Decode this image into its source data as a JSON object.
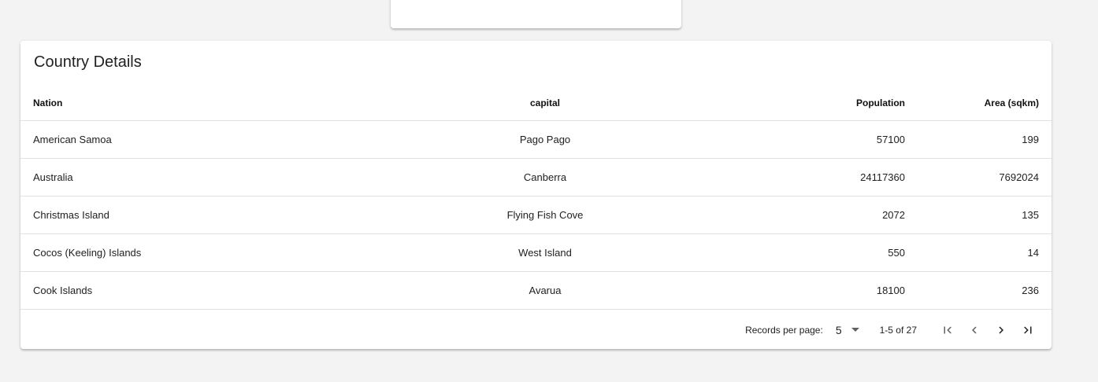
{
  "card": {
    "title": "Country Details"
  },
  "table": {
    "columns": [
      "Nation",
      "capital",
      "Population",
      "Area (sqkm)"
    ],
    "rows": [
      {
        "nation": "American Samoa",
        "capital": "Pago Pago",
        "population": "57100",
        "area": "199"
      },
      {
        "nation": "Australia",
        "capital": "Canberra",
        "population": "24117360",
        "area": "7692024"
      },
      {
        "nation": "Christmas Island",
        "capital": "Flying Fish Cove",
        "population": "2072",
        "area": "135"
      },
      {
        "nation": "Cocos (Keeling) Islands",
        "capital": "West Island",
        "population": "550",
        "area": "14"
      },
      {
        "nation": "Cook Islands",
        "capital": "Avarua",
        "population": "18100",
        "area": "236"
      }
    ]
  },
  "paginator": {
    "records_per_page_label": "Records per page:",
    "records_per_page_value": "5",
    "range_label": "1-5 of 27",
    "icons": [
      "first-page-icon",
      "previous-page-icon",
      "next-page-icon",
      "last-page-icon"
    ]
  }
}
